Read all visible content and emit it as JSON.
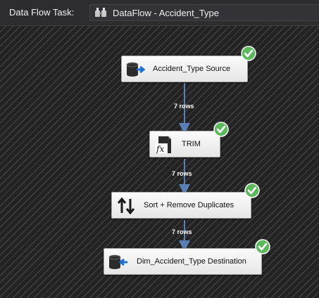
{
  "header": {
    "task_label": "Data Flow Task:",
    "selected_task": "DataFlow - Accident_Type"
  },
  "components": {
    "source": {
      "label": "Accident_Type Source",
      "icon": "source-cylinder-icon",
      "status": "success"
    },
    "trim": {
      "label": "TRIM",
      "icon": "derived-column-fx-icon",
      "status": "success"
    },
    "sort": {
      "label": "Sort + Remove Duplicates",
      "icon": "sort-arrows-icon",
      "status": "success"
    },
    "destination": {
      "label": "Dim_Accident_Type Destination",
      "icon": "destination-cylinder-icon",
      "status": "success"
    }
  },
  "flows": [
    {
      "rows_label": "7 rows"
    },
    {
      "rows_label": "7 rows"
    },
    {
      "rows_label": "7 rows"
    }
  ],
  "colors": {
    "canvas": "#232323",
    "stripe": "#4a4a4a",
    "path": "#5b7fb5",
    "success": "#5cb85c",
    "header_bg": "#2d2d30"
  }
}
